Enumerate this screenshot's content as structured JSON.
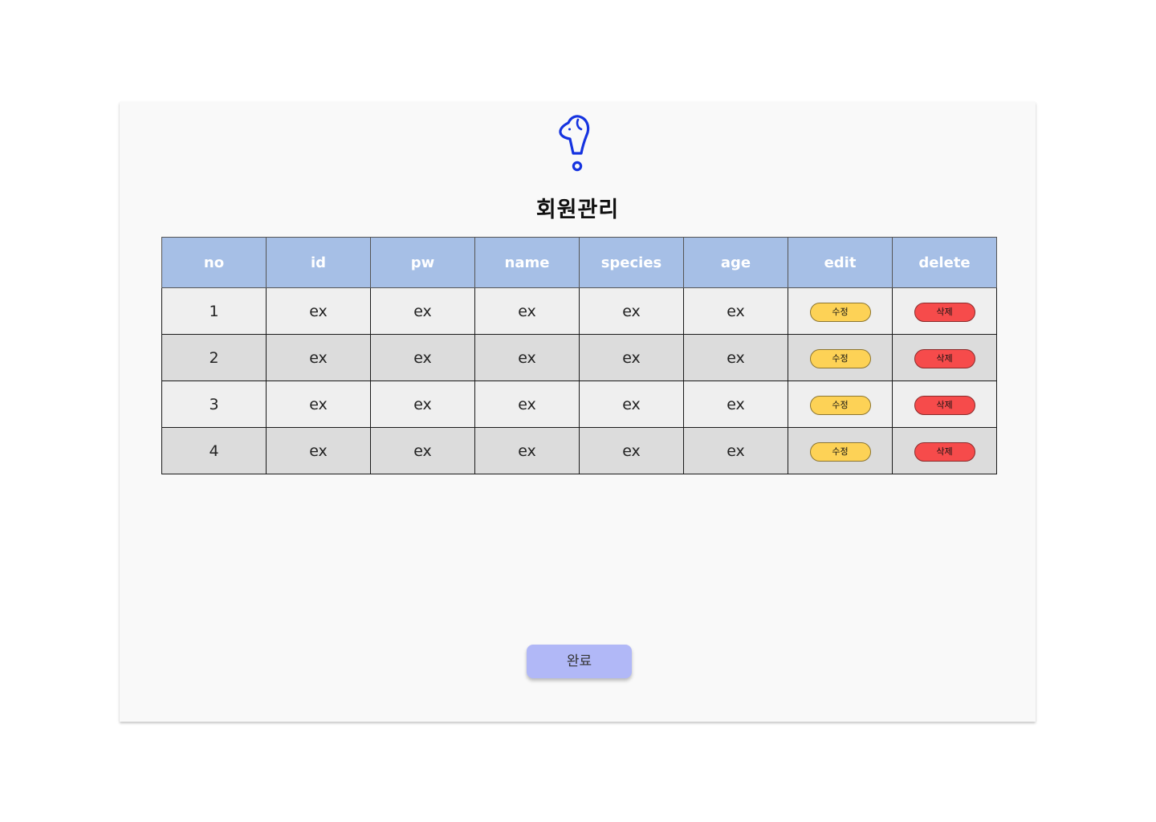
{
  "logo": {
    "icon": "dog-exclamation-logo-icon",
    "color": "#1533e0"
  },
  "page": {
    "title": "회원관리"
  },
  "table": {
    "headers": [
      "no",
      "id",
      "pw",
      "name",
      "species",
      "age",
      "edit",
      "delete"
    ],
    "rows": [
      {
        "no": "1",
        "id": "ex",
        "pw": "ex",
        "name": "ex",
        "species": "ex",
        "age": "ex",
        "edit": "수정",
        "delete": "삭제"
      },
      {
        "no": "2",
        "id": "ex",
        "pw": "ex",
        "name": "ex",
        "species": "ex",
        "age": "ex",
        "edit": "수정",
        "delete": "삭제"
      },
      {
        "no": "3",
        "id": "ex",
        "pw": "ex",
        "name": "ex",
        "species": "ex",
        "age": "ex",
        "edit": "수정",
        "delete": "삭제"
      },
      {
        "no": "4",
        "id": "ex",
        "pw": "ex",
        "name": "ex",
        "species": "ex",
        "age": "ex",
        "edit": "수정",
        "delete": "삭제"
      }
    ]
  },
  "footer": {
    "done_label": "완료"
  },
  "colors": {
    "header_bg": "#a6bfe6",
    "edit_button": "#fdd256",
    "delete_button": "#f64b4b",
    "done_button": "#b1b8f7"
  }
}
